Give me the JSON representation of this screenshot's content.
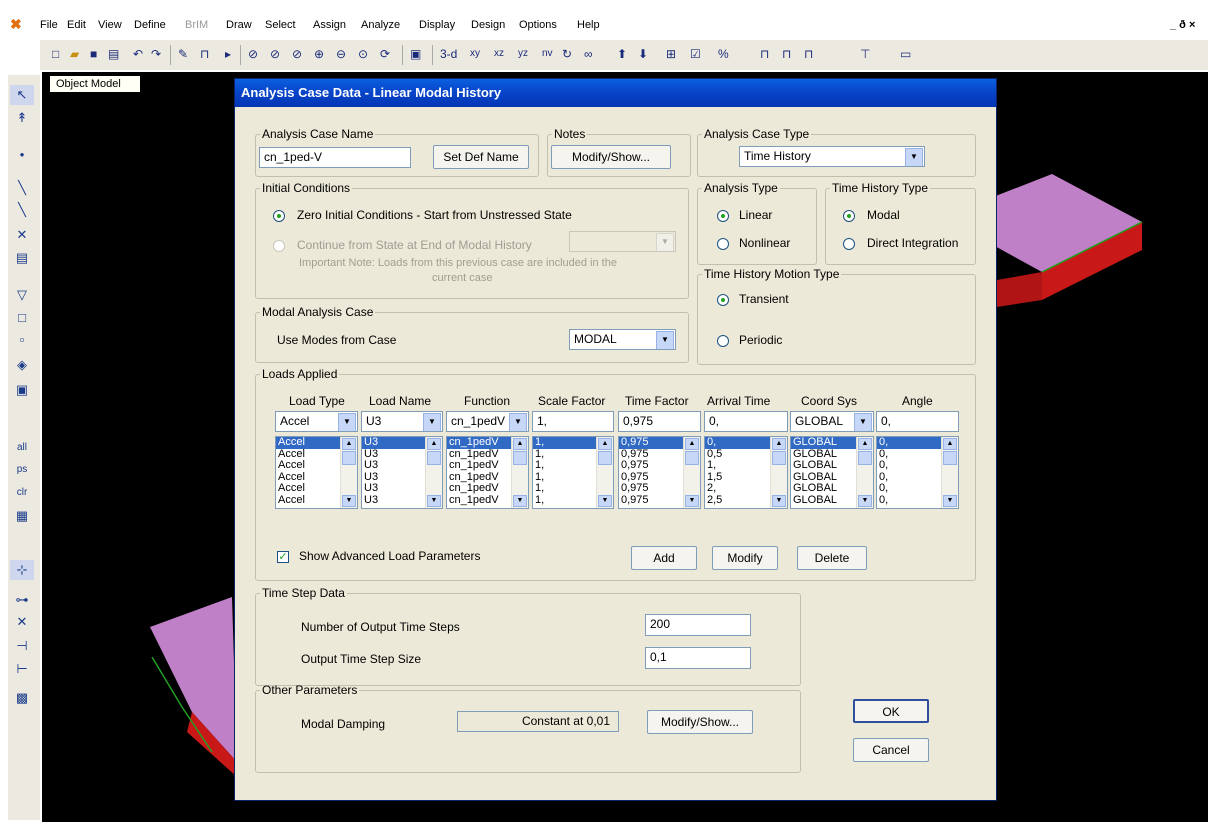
{
  "menu": {
    "items": [
      "File",
      "Edit",
      "View",
      "Define",
      "BrIM",
      "Draw",
      "Select",
      "Assign",
      "Analyze",
      "Display",
      "Design",
      "Options",
      "Help"
    ],
    "disabled_index": 4,
    "window_controls": "_ ð ×"
  },
  "toolbar": {
    "view_buttons": [
      "3-d",
      "xy",
      "xz",
      "yz",
      "nv"
    ]
  },
  "canvas": {
    "tab_label": "Object Model"
  },
  "dialog": {
    "title": "Analysis Case Data - Linear Modal History",
    "case_name": {
      "legend": "Analysis Case Name",
      "value": "cn_1ped-V",
      "button": "Set Def Name"
    },
    "notes": {
      "legend": "Notes",
      "button": "Modify/Show..."
    },
    "case_type": {
      "legend": "Analysis Case Type",
      "value": "Time History"
    },
    "initial_conditions": {
      "legend": "Initial Conditions",
      "option1": "Zero Initial Conditions - Start from Unstressed State",
      "option2": "Continue from State at End of Modal History",
      "note_line1": "Important Note:  Loads from this previous case are included in the",
      "note_line2": "current case"
    },
    "analysis_type": {
      "legend": "Analysis Type",
      "linear": "Linear",
      "nonlinear": "Nonlinear"
    },
    "history_type": {
      "legend": "Time History Type",
      "modal": "Modal",
      "direct": "Direct Integration"
    },
    "motion_type": {
      "legend": "Time History Motion Type",
      "transient": "Transient",
      "periodic": "Periodic"
    },
    "modal_case": {
      "legend": "Modal Analysis Case",
      "label": "Use Modes from Case",
      "value": "MODAL"
    },
    "loads": {
      "legend": "Loads Applied",
      "headers": [
        "Load Type",
        "Load Name",
        "Function",
        "Scale Factor",
        "Time Factor",
        "Arrival Time",
        "Coord Sys",
        "Angle"
      ],
      "edit_row": [
        "Accel",
        "U3",
        "cn_1pedV",
        "1,",
        "0,975",
        "0,",
        "GLOBAL",
        "0,"
      ],
      "columns": [
        [
          "Accel",
          "Accel",
          "Accel",
          "Accel",
          "Accel",
          "Accel"
        ],
        [
          "U3",
          "U3",
          "U3",
          "U3",
          "U3",
          "U3"
        ],
        [
          "cn_1pedV",
          "cn_1pedV",
          "cn_1pedV",
          "cn_1pedV",
          "cn_1pedV",
          "cn_1pedV"
        ],
        [
          "1,",
          "1,",
          "1,",
          "1,",
          "1,",
          "1,"
        ],
        [
          "0,975",
          "0,975",
          "0,975",
          "0,975",
          "0,975",
          "0,975"
        ],
        [
          "0,",
          "0,5",
          "1,",
          "1,5",
          "2,",
          "2,5"
        ],
        [
          "GLOBAL",
          "GLOBAL",
          "GLOBAL",
          "GLOBAL",
          "GLOBAL",
          "GLOBAL"
        ],
        [
          "0,",
          "0,",
          "0,",
          "0,",
          "0,",
          "0,"
        ]
      ],
      "show_advanced": "Show Advanced Load Parameters",
      "add": "Add",
      "modify": "Modify",
      "delete": "Delete"
    },
    "time_step": {
      "legend": "Time Step Data",
      "steps_label": "Number of Output Time Steps",
      "steps_value": "200",
      "size_label": "Output Time Step Size",
      "size_value": "0,1"
    },
    "other": {
      "legend": "Other Parameters",
      "damping_label": "Modal Damping",
      "damping_value": "Constant at 0,01",
      "button": "Modify/Show..."
    },
    "ok": "OK",
    "cancel": "Cancel"
  },
  "colors": {
    "title_bar": "#0843c8",
    "dialog_bg": "#ece9d8",
    "selection": "#316ac5",
    "model_magenta": "#c080c8",
    "model_red": "#c81818"
  }
}
